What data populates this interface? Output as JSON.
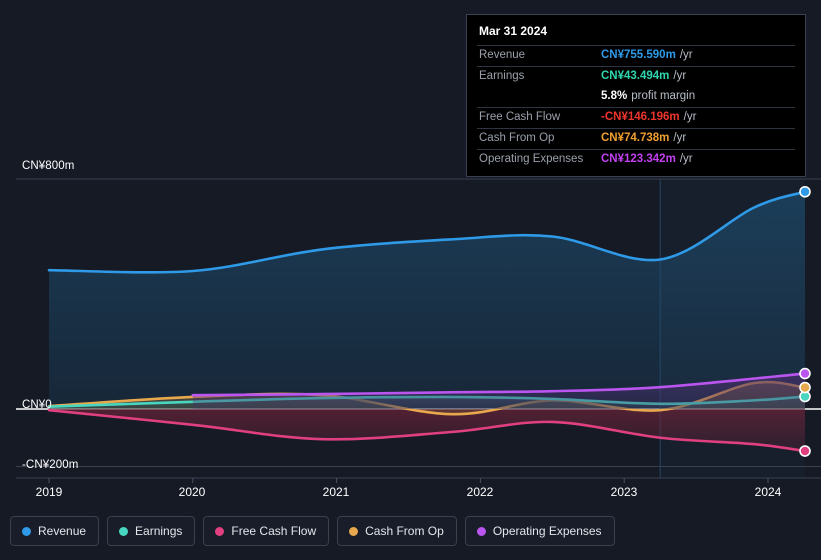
{
  "chart_data": {
    "type": "area",
    "title": "",
    "xlabel": "",
    "ylabel": "",
    "currency": "CN¥",
    "grid": true,
    "legend_position": "bottom",
    "x": [
      2019,
      2020,
      2021,
      2022,
      2023,
      2024
    ],
    "xlim": [
      2018.85,
      2024.4
    ],
    "ylim": [
      -260,
      800
    ],
    "yticks": [
      {
        "value": 800,
        "label": "CN¥800m"
      },
      {
        "value": 0,
        "label": "CN¥0"
      },
      {
        "value": -200,
        "label": "-CN¥200m"
      }
    ],
    "xticks": [
      "2019",
      "2020",
      "2021",
      "2022",
      "2023",
      "2024"
    ],
    "forecast_divider_x": 2023.25,
    "series": [
      {
        "name": "Revenue",
        "color": "#2e9ae8",
        "fill": "#1d4a6b",
        "start_x": 2019,
        "end_value": 755.59,
        "values": [
          483,
          480,
          555,
          590,
          600,
          520,
          700,
          755.59
        ],
        "x_points": [
          2019,
          2020,
          2020.9,
          2021.8,
          2022.5,
          2023.25,
          2023.9,
          2024.3
        ]
      },
      {
        "name": "Earnings",
        "color": "#48d6c0",
        "fill": "#2f5a59",
        "start_x": 2019,
        "end_value": 43.494,
        "values": [
          8,
          25,
          38,
          42,
          35,
          18,
          30,
          43.494
        ],
        "x_points": [
          2019,
          2020,
          2020.9,
          2021.8,
          2022.5,
          2023.25,
          2023.9,
          2024.3
        ]
      },
      {
        "name": "Free Cash Flow",
        "color": "#e0407f",
        "fill": "#6a2338",
        "start_x": 2019,
        "end_value": -146.196,
        "values": [
          -4,
          -55,
          -105,
          -80,
          -45,
          -100,
          -122,
          -146.196
        ],
        "x_points": [
          2019,
          2020,
          2020.9,
          2021.8,
          2022.5,
          2023.25,
          2023.9,
          2024.3
        ]
      },
      {
        "name": "Cash From Op",
        "color": "#e8a84d",
        "fill": "#7a6138",
        "start_x": 2019,
        "end_value": 74.738,
        "values": [
          10,
          42,
          48,
          -18,
          30,
          -4,
          90,
          74.738
        ],
        "x_points": [
          2019,
          2020,
          2020.9,
          2021.8,
          2022.5,
          2023.25,
          2023.9,
          2024.3
        ]
      },
      {
        "name": "Operating Expenses",
        "color": "#bb55f0",
        "fill": "#4a2f6e",
        "start_x": 2020,
        "end_value": 123.342,
        "values": [
          48,
          52,
          58,
          62,
          76,
          123.342
        ],
        "x_points": [
          2020,
          2020.9,
          2021.8,
          2022.5,
          2023.25,
          2024.3
        ]
      }
    ]
  },
  "tooltip": {
    "date": "Mar 31 2024",
    "rows": [
      {
        "key": "Revenue",
        "value": "CN¥755.590m",
        "unit": "/yr",
        "color": "#2e9ae8"
      },
      {
        "key": "Earnings",
        "value": "CN¥43.494m",
        "unit": "/yr",
        "color": "#2fd6ae"
      },
      {
        "key": "",
        "value": "5.8%",
        "sub": "profit margin",
        "color": "#ffffff"
      },
      {
        "key": "Free Cash Flow",
        "value": "-CN¥146.196m",
        "unit": "/yr",
        "color": "#f0352d"
      },
      {
        "key": "Cash From Op",
        "value": "CN¥74.738m",
        "unit": "/yr",
        "color": "#f0a030"
      },
      {
        "key": "Operating Expenses",
        "value": "CN¥123.342m",
        "unit": "/yr",
        "color": "#c240f0"
      }
    ]
  },
  "legend": {
    "items": [
      {
        "label": "Revenue",
        "color": "#2e9ae8"
      },
      {
        "label": "Earnings",
        "color": "#48d6c0"
      },
      {
        "label": "Free Cash Flow",
        "color": "#e0407f"
      },
      {
        "label": "Cash From Op",
        "color": "#e8a84d"
      },
      {
        "label": "Operating Expenses",
        "color": "#bb55f0"
      }
    ]
  }
}
